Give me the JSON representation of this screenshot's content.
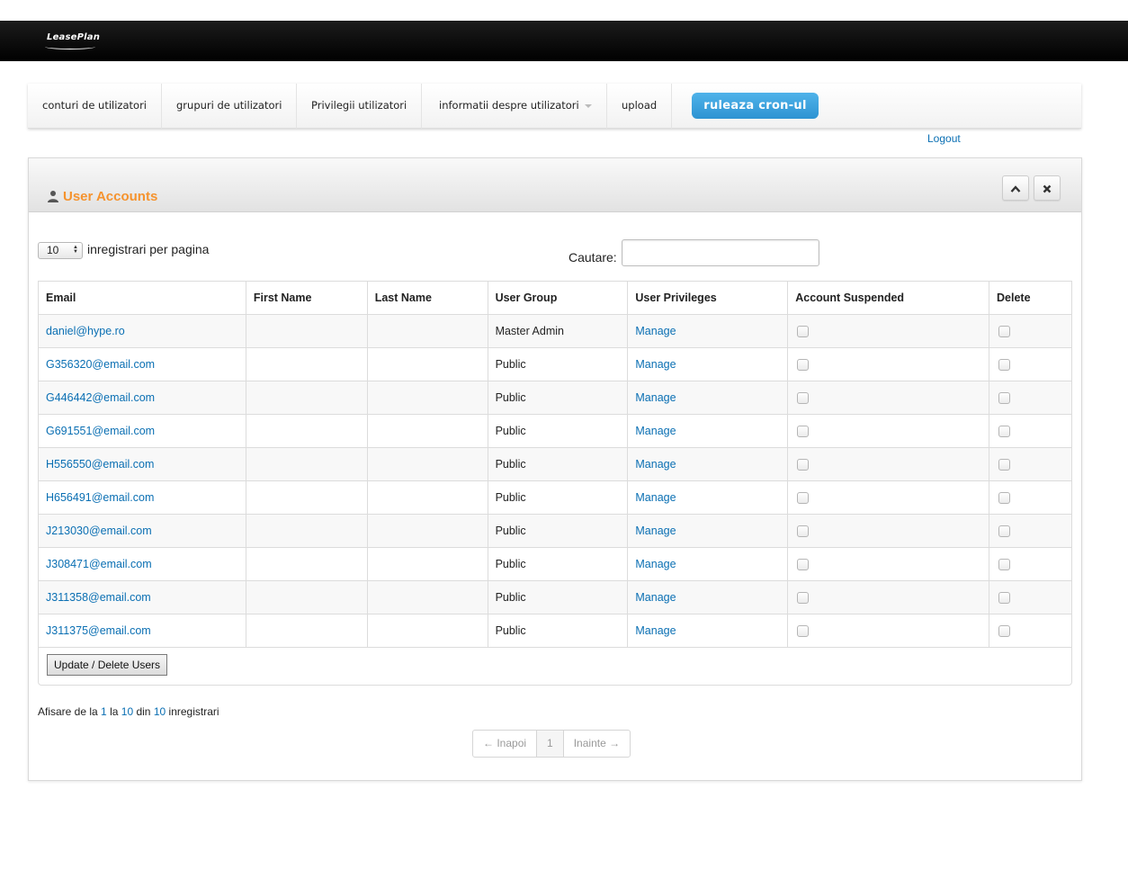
{
  "brand": {
    "logo_text": "LeasePlan"
  },
  "nav": {
    "items": [
      {
        "label": "conturi de utilizatori"
      },
      {
        "label": "grupuri de utilizatori"
      },
      {
        "label": "Privilegii utilizatori"
      },
      {
        "label": "informatii despre utilizatori",
        "has_dropdown": true
      },
      {
        "label": "upload"
      }
    ],
    "cron_button": "ruleaza cron-ul"
  },
  "logout_label": "Logout",
  "panel": {
    "title": "User Accounts",
    "collapse_icon": "chevron-up-icon",
    "close_icon": "close-icon"
  },
  "table_controls": {
    "page_length": "10",
    "page_length_label": "inregistrari per pagina",
    "search_label": "Cautare:",
    "search_value": ""
  },
  "table": {
    "headers": [
      "Email",
      "First Name",
      "Last Name",
      "User Group",
      "User Privileges",
      "Account Suspended",
      "Delete"
    ],
    "rows": [
      {
        "email": "daniel@hype.ro",
        "first_name": "",
        "last_name": "",
        "group": "Master Admin",
        "privileges": "Manage",
        "suspended": false,
        "delete": false
      },
      {
        "email": "G356320@email.com",
        "first_name": "",
        "last_name": "",
        "group": "Public",
        "privileges": "Manage",
        "suspended": false,
        "delete": false
      },
      {
        "email": "G446442@email.com",
        "first_name": "",
        "last_name": "",
        "group": "Public",
        "privileges": "Manage",
        "suspended": false,
        "delete": false
      },
      {
        "email": "G691551@email.com",
        "first_name": "",
        "last_name": "",
        "group": "Public",
        "privileges": "Manage",
        "suspended": false,
        "delete": false
      },
      {
        "email": "H556550@email.com",
        "first_name": "",
        "last_name": "",
        "group": "Public",
        "privileges": "Manage",
        "suspended": false,
        "delete": false
      },
      {
        "email": "H656491@email.com",
        "first_name": "",
        "last_name": "",
        "group": "Public",
        "privileges": "Manage",
        "suspended": false,
        "delete": false
      },
      {
        "email": "J213030@email.com",
        "first_name": "",
        "last_name": "",
        "group": "Public",
        "privileges": "Manage",
        "suspended": false,
        "delete": false
      },
      {
        "email": "J308471@email.com",
        "first_name": "",
        "last_name": "",
        "group": "Public",
        "privileges": "Manage",
        "suspended": false,
        "delete": false
      },
      {
        "email": "J311358@email.com",
        "first_name": "",
        "last_name": "",
        "group": "Public",
        "privileges": "Manage",
        "suspended": false,
        "delete": false
      },
      {
        "email": "J311375@email.com",
        "first_name": "",
        "last_name": "",
        "group": "Public",
        "privileges": "Manage",
        "suspended": false,
        "delete": false
      }
    ],
    "update_button": "Update / Delete Users"
  },
  "info": {
    "prefix": "Afisare de la",
    "from": "1",
    "la": "la",
    "to": "10",
    "din": "din",
    "total": "10",
    "suffix": "inregistrari"
  },
  "pagination": {
    "prev": "← Inapoi",
    "current": "1",
    "next": "Inainte →"
  }
}
